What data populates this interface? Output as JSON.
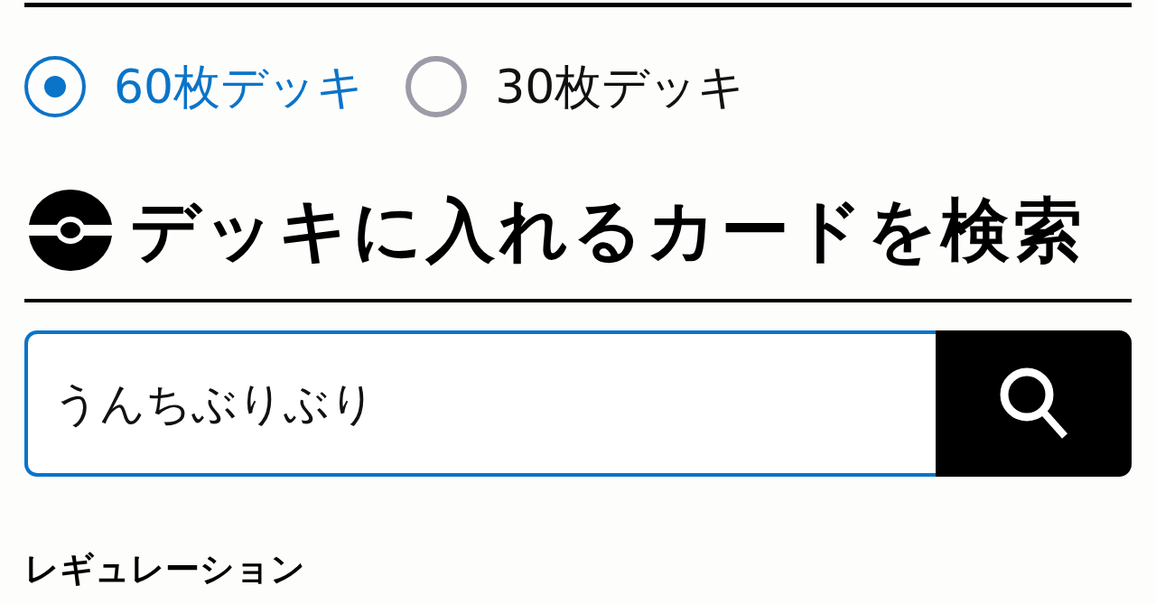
{
  "deck_size": [
    {
      "label": "60枚デッキ",
      "selected": true
    },
    {
      "label": "30枚デッキ",
      "selected": false
    }
  ],
  "search_section": {
    "title": "デッキに入れるカードを検索",
    "search": {
      "value": "うんちぶりぶり"
    }
  },
  "filters": {
    "title": "レギュレーション"
  }
}
